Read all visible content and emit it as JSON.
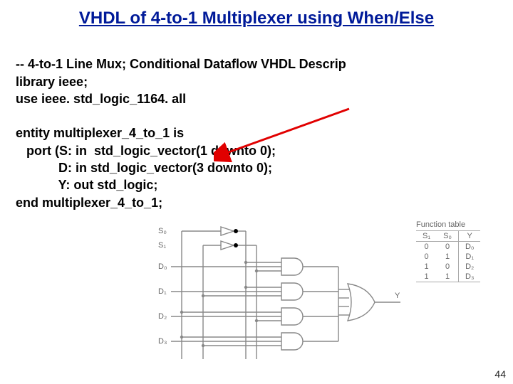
{
  "title": "VHDL of 4-to-1 Multiplexer using When/Else",
  "code": {
    "l1": "-- 4-to-1 Line Mux; Conditional Dataflow VHDL Descrip",
    "l2": "library ieee;",
    "l3": "use ieee. std_logic_1164. all",
    "l4": "",
    "l5": "entity multiplexer_4_to_1 is",
    "l6": "   port (S: in  std_logic_vector(1 downto 0);",
    "l7": "            D: in std_logic_vector(3 downto 0);",
    "l8": "            Y: out std_logic;",
    "l9": "end multiplexer_4_to_1;"
  },
  "labels": {
    "s0": "S₀",
    "s1": "S₁",
    "d0": "D₀",
    "d1": "D₁",
    "d2": "D₂",
    "d3": "D₃",
    "y": "Y"
  },
  "ftable": {
    "title": "Function table",
    "headers": [
      "S₁",
      "S₀",
      "Y"
    ],
    "rows": [
      [
        "0",
        "0",
        "D₀"
      ],
      [
        "0",
        "1",
        "D₁"
      ],
      [
        "1",
        "0",
        "D₂"
      ],
      [
        "1",
        "1",
        "D₃"
      ]
    ]
  },
  "page": "44"
}
